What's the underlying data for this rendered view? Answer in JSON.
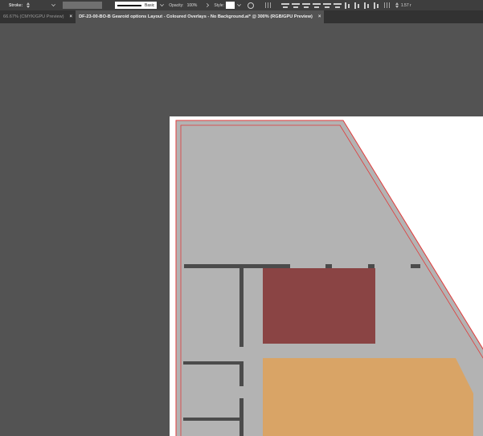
{
  "control_bar": {
    "stroke_label": "Stroke:",
    "stroke_profile_label": "Basic",
    "opacity_label": "Opacity:",
    "opacity_value": "100%",
    "style_label": "Style:",
    "width_value": "1.57 r"
  },
  "tabs": [
    {
      "label": "66.67% (CMYK/GPU Preview)",
      "close": "×"
    },
    {
      "label": "DF-23-00-BO-B Gearoid options Layout - Coloured Overlays - No Background.ai* @ 300% (RGB/GPU Preview)",
      "close": "×"
    }
  ],
  "colors": {
    "canvas_bg": "#535353",
    "artboard": "#ffffff",
    "floor_grey": "#b3b3b3",
    "wall": "#4b4b4b",
    "room_red": "#8a4444",
    "room_orange": "#d9a466",
    "outline_red": "#e03a3a"
  },
  "icons": [
    "stroke-stepper-icon",
    "dropdown-chevron-icon",
    "globe-icon",
    "grid-icon",
    "align-icon",
    "distribute-icon"
  ]
}
